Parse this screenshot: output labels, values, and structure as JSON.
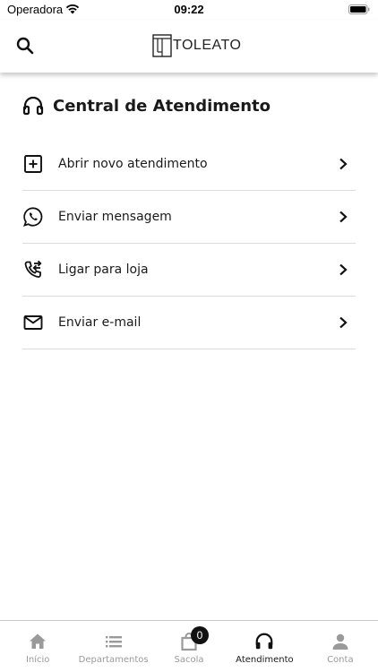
{
  "status_bar": {
    "carrier": "Operadora",
    "time": "09:22"
  },
  "header": {
    "logo_text": "TOLEATO"
  },
  "main": {
    "title": "Central de Atendimento",
    "items": [
      {
        "label": "Abrir novo atendimento",
        "icon": "plus-square-icon"
      },
      {
        "label": "Enviar mensagem",
        "icon": "whatsapp-icon"
      },
      {
        "label": "Ligar para loja",
        "icon": "phone-forward-icon"
      },
      {
        "label": "Enviar e-mail",
        "icon": "mail-icon"
      }
    ]
  },
  "tab_bar": {
    "tabs": [
      {
        "label": "Início",
        "icon": "home-icon"
      },
      {
        "label": "Departamentos",
        "icon": "list-icon"
      },
      {
        "label": "Sacola",
        "icon": "bag-icon",
        "badge": "0"
      },
      {
        "label": "Atendimento",
        "icon": "headphones-icon",
        "active": true
      },
      {
        "label": "Conta",
        "icon": "person-icon"
      }
    ]
  }
}
